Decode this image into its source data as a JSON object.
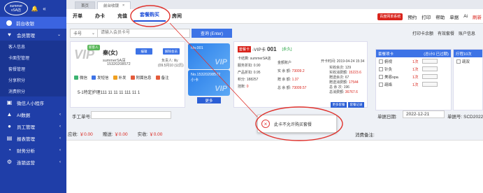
{
  "sidebar": {
    "logo_line1": "summer",
    "logo_line2": "vSA店",
    "items": [
      {
        "label": "前台收银",
        "icon": "cashier-icon",
        "active": true
      },
      {
        "label": "会员管理",
        "icon": "member-icon",
        "active": false
      }
    ],
    "sub_items": [
      "客人信息",
      "卡面型管理",
      "套餐管理",
      "分享积分",
      "消费积分"
    ],
    "items2": [
      {
        "label": "微信人小程序",
        "icon": "wechat-icon"
      },
      {
        "label": "AI数据",
        "icon": "ai-icon"
      },
      {
        "label": "员工管理",
        "icon": "staff-icon"
      },
      {
        "label": "报表管理",
        "icon": "report-icon"
      },
      {
        "label": "财务分析",
        "icon": "finance-icon"
      },
      {
        "label": "连锁运营",
        "icon": "chain-icon"
      }
    ]
  },
  "tabs": [
    {
      "label": "首页"
    },
    {
      "label": "前台收银",
      "close": "×"
    }
  ],
  "menubar": {
    "items": [
      "开单",
      "办卡",
      "充值",
      "套餐购买",
      "房间"
    ],
    "active": "套餐购买",
    "right_badge": "百度网单系统",
    "right_links": [
      "预约",
      "打印",
      "帮助",
      "单据",
      "Ai",
      "刷新"
    ]
  },
  "search": {
    "select_value": "卡号",
    "placeholder": "请输入会员卡号",
    "button": "查询 (Enter)",
    "right_tools": [
      "打印卡余额",
      "有效套餐",
      "账户信息"
    ]
  },
  "member": {
    "name": "秦(女)",
    "new_badge": "新客人",
    "store": "summerSA店",
    "phone": "15320208572",
    "btn_edit": "编辑",
    "btn_unbind": "解除会员",
    "owner": "负责人: lily",
    "date": "(09.5月10 (公历)",
    "actions": [
      "微信",
      "发短信",
      "补发",
      "附属信息",
      "备注"
    ],
    "note": "5-1特定护理111 11 11 11 111 11 1"
  },
  "vip_cards": [
    {
      "no": "No.001",
      "vip": "VIP"
    },
    {
      "no": "No.15320208572",
      "label": "小卡",
      "vip": "VIP"
    }
  ],
  "more_button": "更多",
  "detail": {
    "tag": "套餐卡",
    "title": "-VIP卡",
    "num": "001",
    "year": "[永久]",
    "lines": [
      {
        "label": "卡结算: ",
        "value": "summerSA店"
      },
      {
        "label": "服务折扣: ",
        "value": "0.90"
      },
      {
        "label": "产品折扣: ",
        "value": "0.95"
      },
      {
        "label": "积分: ",
        "value": "188257"
      },
      {
        "label": "挂账: ",
        "value": "0"
      },
      {
        "label": "金额账户 ",
        "value": ""
      },
      {
        "label": "实 余 额: ",
        "value": "73009.2"
      },
      {
        "label": "赠 余 额: ",
        "value": "1.37"
      },
      {
        "label": "总 余 额: ",
        "value": "73009.57"
      },
      {
        "label": "开卡时间: ",
        "value": "2019-04-24 15:34"
      },
      {
        "label": "实收余次: ",
        "value": "129"
      },
      {
        "label": "实收消费额: ",
        "value": "15223.6"
      },
      {
        "label": "赠送余次: ",
        "value": "67"
      },
      {
        "label": "赠送消费额: ",
        "value": "17544"
      },
      {
        "label": "总 余 次: ",
        "value": "196"
      },
      {
        "label": "总消费额: ",
        "value": "36767.6"
      }
    ],
    "btn_more": "更多套餐",
    "btn_rec": "套餐记录"
  },
  "dialog": {
    "message": "此卡不允许购买套餐"
  },
  "set_panel": {
    "header_left": "套餐项卡",
    "header_right": "(总计0 已过期)",
    "rows": [
      {
        "name": "俯视",
        "count": "1次"
      },
      {
        "name": "针灸",
        "count": "1次"
      },
      {
        "name": "美容spa",
        "count": "1次"
      },
      {
        "name": "疏络",
        "count": "1次"
      }
    ]
  },
  "pkg_panel": {
    "header": "疗程10次",
    "rows": [
      "疏双"
    ]
  },
  "handwork": {
    "label": "手工单号:"
  },
  "bill": {
    "date_label": "单据日期:",
    "date_value": "2022-12-21",
    "no_label": "单据号: SCD202212"
  },
  "totals": [
    {
      "label": "应收: ",
      "value": "￥0.00"
    },
    {
      "label": "赠送: ",
      "value": "￥0.00"
    },
    {
      "label": "实收: ",
      "value": "￥0.00"
    }
  ],
  "consume_note_label": "消费备注:"
}
